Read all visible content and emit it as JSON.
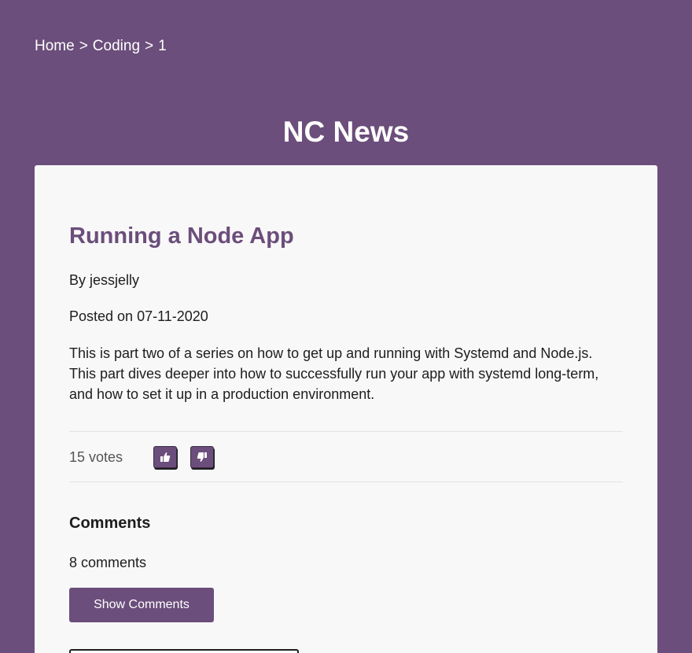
{
  "breadcrumb": {
    "items": [
      "Home",
      "Coding",
      "1"
    ],
    "separator": ">"
  },
  "site": {
    "title": "NC News"
  },
  "article": {
    "title": "Running a Node App",
    "author_line": "By jessjelly",
    "posted_line": "Posted on 07-11-2020",
    "body": "This is part two of a series on how to get up and running with Systemd and Node.js. This part dives deeper into how to successfully run your app with systemd long-term, and how to set it up in a production environment."
  },
  "votes": {
    "label": "15 votes",
    "upvote_icon": "thumbs-up-icon",
    "downvote_icon": "thumbs-down-icon"
  },
  "comments": {
    "heading": "Comments",
    "count_label": "8 comments",
    "show_button_label": "Show Comments"
  },
  "colors": {
    "brand": "#6b4e7b",
    "card_background": "#f8f8f8",
    "text": "#1d1d1d"
  }
}
